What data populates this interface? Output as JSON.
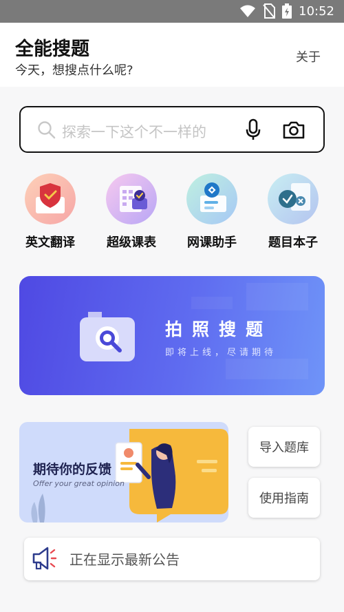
{
  "status_bar": {
    "time": "10:52"
  },
  "header": {
    "title": "全能搜题",
    "subtitle": "今天，想搜点什么呢?",
    "about_label": "关于"
  },
  "search": {
    "placeholder": "探索一下这个不一样的"
  },
  "features": [
    {
      "label": "英文翻译",
      "icon": "shield-translate-icon"
    },
    {
      "label": "超级课表",
      "icon": "schedule-icon"
    },
    {
      "label": "网课助手",
      "icon": "course-assistant-icon"
    },
    {
      "label": "题目本子",
      "icon": "question-notebook-icon"
    }
  ],
  "banner": {
    "title": "拍照搜题",
    "subtitle": "即将上线，尽请期待"
  },
  "feedback": {
    "title": "期待你的反馈",
    "subtitle": "Offer your great opinion"
  },
  "side_buttons": {
    "import_label": "导入题库",
    "guide_label": "使用指南"
  },
  "notice": {
    "text": "正在显示最新公告"
  },
  "colors": {
    "accent": "#5b5ff0",
    "banner_start": "#4f49e3",
    "banner_end": "#6f94f8"
  }
}
